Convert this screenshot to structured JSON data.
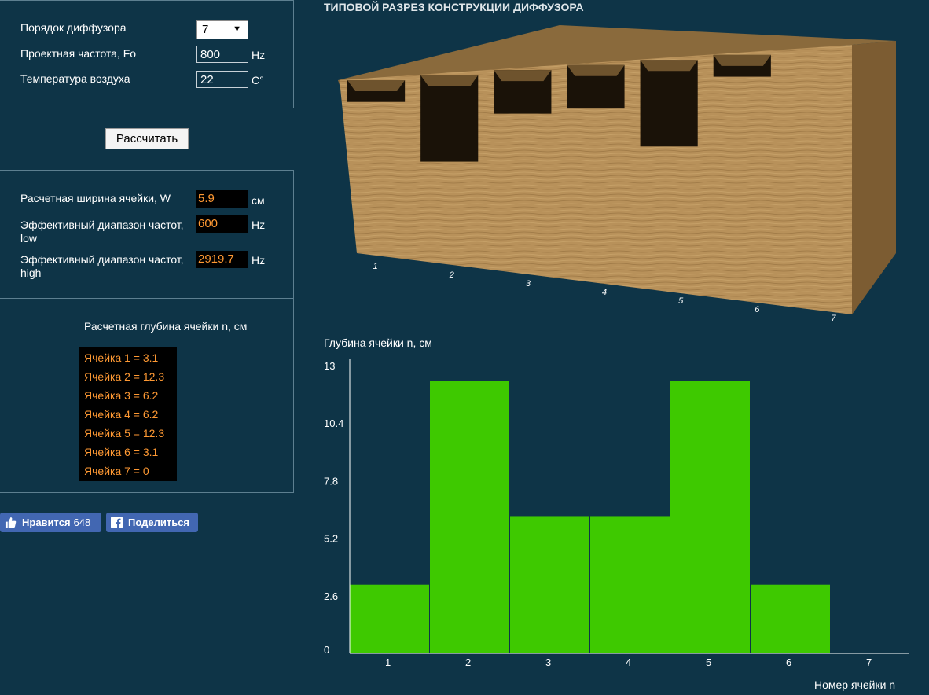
{
  "params": {
    "order_label": "Порядок диффузора",
    "order_value": "7",
    "freq_label": "Проектная частота, Fo",
    "freq_value": "800",
    "freq_unit": "Hz",
    "temp_label": "Температура воздуха",
    "temp_value": "22",
    "temp_unit": "C°"
  },
  "calc_button": "Рассчитать",
  "results": {
    "width_label": "Расчетная ширина ячейки, W",
    "width_value": "5.9",
    "width_unit": "см",
    "low_label_1": "Эффективный диапазон частот,",
    "low_label_2": "low",
    "low_value": "600",
    "low_unit": "Hz",
    "high_label_1": "Эффективный диапазон частот,",
    "high_label_2": "high",
    "high_value": "2919.7",
    "high_unit": "Hz"
  },
  "cells": {
    "title": "Расчетная глубина ячейки n, см",
    "items": [
      "Ячейка 1 = 3.1",
      "Ячейка 2 = 12.3",
      "Ячейка 3 = 6.2",
      "Ячейка 4 = 6.2",
      "Ячейка 5 = 12.3",
      "Ячейка 6 = 3.1",
      "Ячейка 7 = 0"
    ]
  },
  "social": {
    "like_label": "Нравится",
    "like_count": "648",
    "share_label": "Поделиться",
    "brand_color": "#4267b2"
  },
  "diagram": {
    "title": "ТИПОВОЙ РАЗРЕЗ КОНСТРУКЦИИ ДИФФУЗОРА",
    "well_labels": [
      "1",
      "2",
      "3",
      "4",
      "5",
      "6",
      "7"
    ],
    "well_depths": [
      3.1,
      12.3,
      6.2,
      6.2,
      12.3,
      3.1,
      0
    ],
    "wood_color": "#b8915a"
  },
  "chart_data": {
    "type": "bar",
    "title": "",
    "ylabel": "Глубина ячейки n, см",
    "xlabel": "Номер ячейки n",
    "categories": [
      "1",
      "2",
      "3",
      "4",
      "5",
      "6",
      "7"
    ],
    "values": [
      3.1,
      12.3,
      6.2,
      6.2,
      12.3,
      3.1,
      0
    ],
    "yticks": [
      "13",
      "10.4",
      "7.8",
      "5.2",
      "2.6",
      "0"
    ],
    "ylim": [
      0,
      13
    ],
    "bar_color": "#3ec900",
    "grid": false
  }
}
